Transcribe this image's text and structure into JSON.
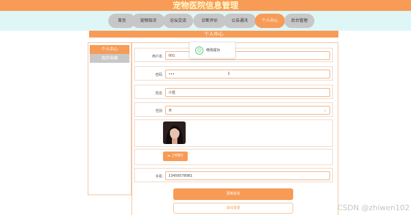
{
  "site_title": "宠物医院信息管理",
  "nav": [
    "首页",
    "宠物知识",
    "论坛交流",
    "诊断评价",
    "公告通讯",
    "个人中心",
    "后台管理"
  ],
  "banner_title": "个人中心",
  "sidebar": {
    "items": [
      "个人中心",
      "我的收藏"
    ]
  },
  "toast": {
    "text": "修改成功"
  },
  "form": {
    "username": {
      "label": "用户名",
      "value": "001"
    },
    "password": {
      "label": "密码",
      "value": "•••"
    },
    "name": {
      "label": "姓名",
      "value": "小蓝"
    },
    "gender": {
      "label": "性别",
      "value": "女"
    },
    "upload_label": "上传图片",
    "phone": {
      "label": "手机",
      "value": "13456578981"
    }
  },
  "buttons": {
    "update": "更新信息",
    "logout": "退出登录"
  },
  "watermark": "CSDN @zhiwen102",
  "colors": {
    "accent": "#f79b56",
    "nav_bg": "#dff6f6",
    "gray_button": "#c7c7c7"
  },
  "icons": {
    "toast": "check-circle-icon",
    "upload": "upload-cloud-icon",
    "dropdown": "chevron-down-icon"
  }
}
